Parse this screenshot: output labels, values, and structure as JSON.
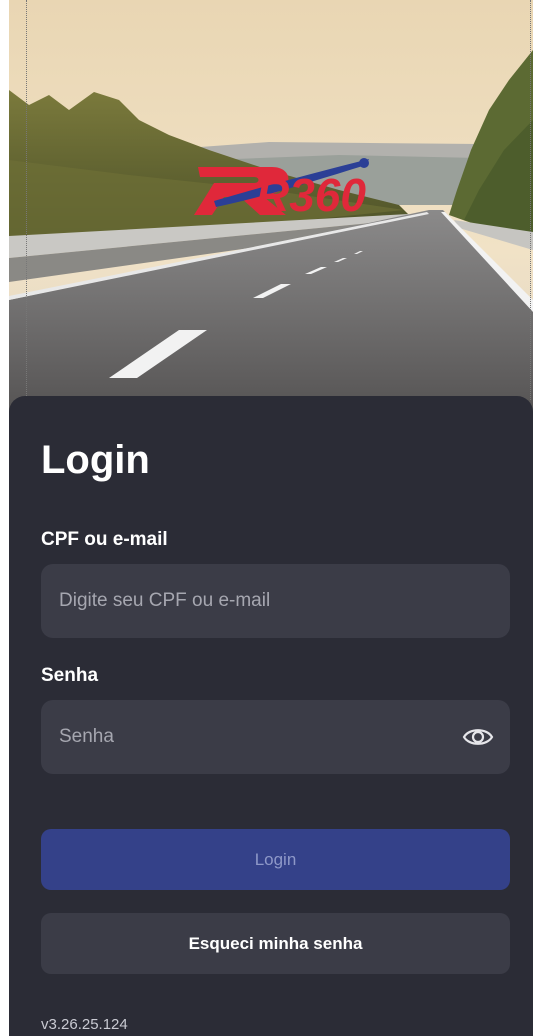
{
  "hero": {
    "logo_text": "R360",
    "logo_colors": {
      "red": "#e0283a",
      "blue": "#2b3f96"
    }
  },
  "form": {
    "title": "Login",
    "cpf_label": "CPF ou e-mail",
    "cpf_placeholder": "Digite seu CPF ou e-mail",
    "cpf_value": "",
    "password_label": "Senha",
    "password_placeholder": "Senha",
    "password_value": "",
    "password_toggle_icon": "eye-icon"
  },
  "actions": {
    "login_label": "Login",
    "forgot_label": "Esqueci minha senha"
  },
  "footer": {
    "version": "v3.26.25.124"
  },
  "colors": {
    "card_bg": "#2b2c36",
    "field_bg": "#3b3c47",
    "primary_button": "#344189",
    "primary_button_text": "#8e98c8"
  }
}
